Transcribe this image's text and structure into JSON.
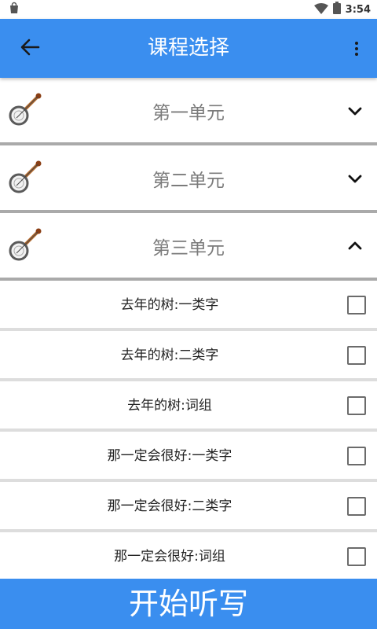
{
  "status_bar": {
    "time": "3:54"
  },
  "app_bar": {
    "title": "课程选择"
  },
  "units": [
    {
      "title": "第一单元",
      "expanded": false
    },
    {
      "title": "第二单元",
      "expanded": false
    },
    {
      "title": "第三单元",
      "expanded": true
    }
  ],
  "lessons": [
    {
      "label": "去年的树:一类字",
      "checked": false
    },
    {
      "label": "去年的树:二类字",
      "checked": false
    },
    {
      "label": "去年的树:词组",
      "checked": false
    },
    {
      "label": "那一定会很好:一类字",
      "checked": false
    },
    {
      "label": "那一定会很好:二类字",
      "checked": false
    },
    {
      "label": "那一定会很好:词组",
      "checked": false
    }
  ],
  "start_button": {
    "label": "开始听写"
  },
  "colors": {
    "primary": "#3a8eef",
    "divider_unit": "#aaaaaa",
    "divider_item": "#dddddd"
  },
  "icons": {
    "unit_icon": "banjo-icon",
    "back": "arrow-left-icon",
    "menu": "more-vert-icon"
  }
}
